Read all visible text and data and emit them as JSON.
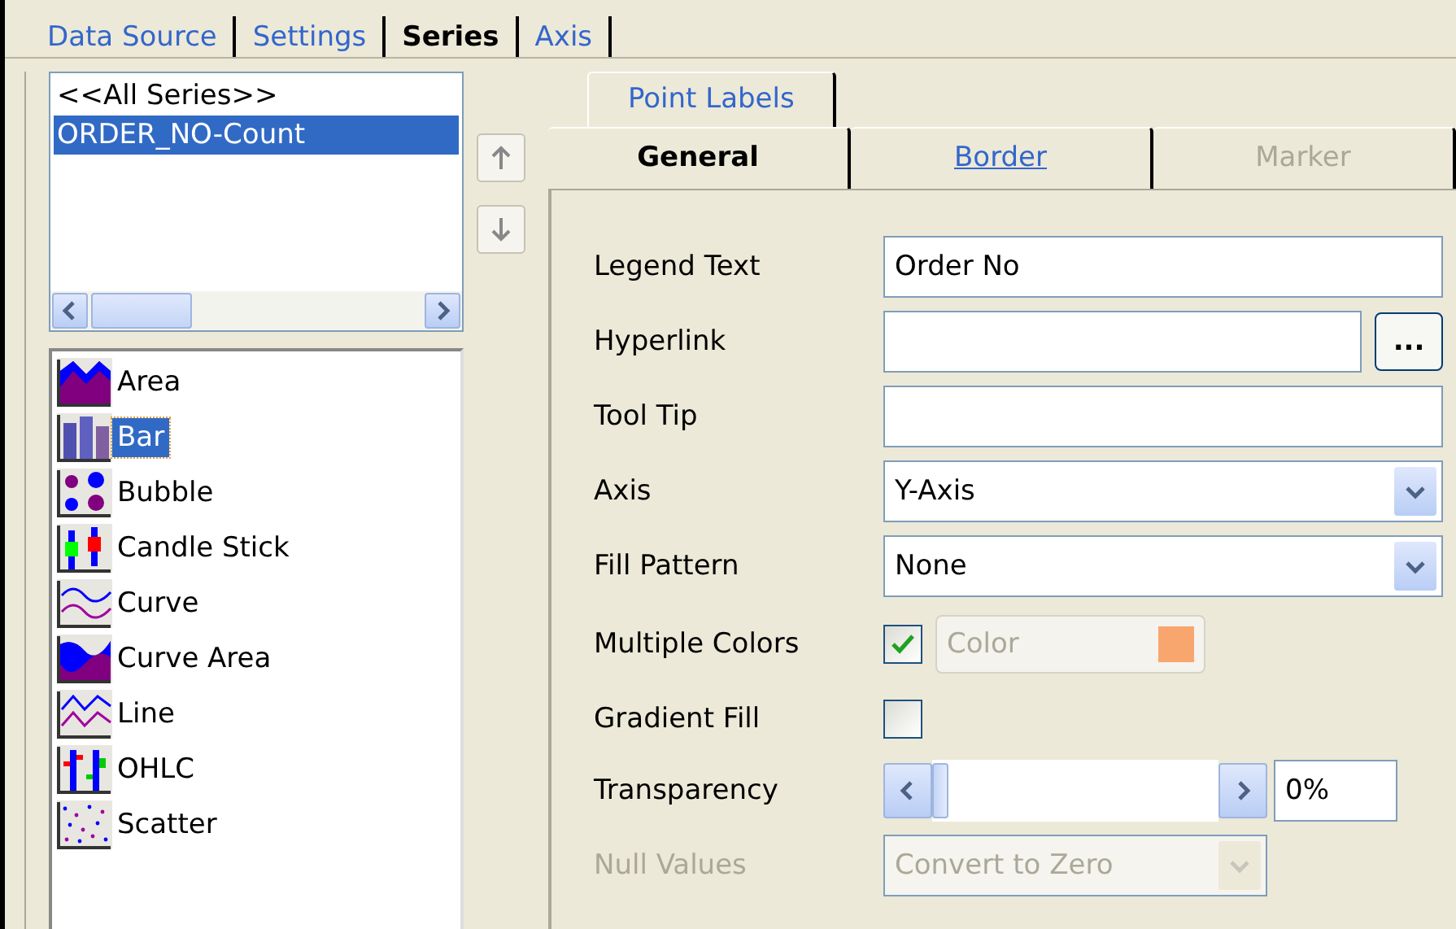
{
  "tabs": [
    {
      "label": "Data Source",
      "selected": false
    },
    {
      "label": "Settings",
      "selected": false
    },
    {
      "label": "Series",
      "selected": true
    },
    {
      "label": "Axis",
      "selected": false
    }
  ],
  "series_list": [
    {
      "label": "<<All Series>>",
      "selected": false
    },
    {
      "label": "ORDER_NO-Count",
      "selected": true
    }
  ],
  "chart_types": [
    {
      "label": "Area",
      "kind": "area",
      "selected": false
    },
    {
      "label": "Bar",
      "kind": "bar",
      "selected": true
    },
    {
      "label": "Bubble",
      "kind": "bubble",
      "selected": false
    },
    {
      "label": "Candle Stick",
      "kind": "candle",
      "selected": false
    },
    {
      "label": "Curve",
      "kind": "curve",
      "selected": false
    },
    {
      "label": "Curve Area",
      "kind": "curvearea",
      "selected": false
    },
    {
      "label": "Line",
      "kind": "line",
      "selected": false
    },
    {
      "label": "OHLC",
      "kind": "ohlc",
      "selected": false
    },
    {
      "label": "Scatter",
      "kind": "scatter",
      "selected": false
    }
  ],
  "upper_tabs": [
    {
      "label": "Point Labels",
      "selected": false,
      "disabled": false
    }
  ],
  "lower_tabs": [
    {
      "label": "General",
      "selected": true,
      "disabled": false
    },
    {
      "label": "Border",
      "selected": false,
      "disabled": false
    },
    {
      "label": "Marker",
      "selected": false,
      "disabled": true
    }
  ],
  "fields": [
    {
      "kind": "text",
      "label": "Legend Text",
      "value": "Order No",
      "disabled": false
    },
    {
      "kind": "browse",
      "label": "Hyperlink",
      "button": "...",
      "disabled": false
    },
    {
      "kind": "text",
      "label": "Tool Tip",
      "disabled": false
    },
    {
      "kind": "select",
      "label": "Axis",
      "value": "Y-Axis",
      "disabled": false
    },
    {
      "kind": "select",
      "label": "Fill Pattern",
      "value": "None",
      "disabled": false
    },
    {
      "kind": "checkcolor",
      "label": "Multiple Colors",
      "checked": true,
      "color_label": "Color",
      "color": "#f9a66e",
      "disabled": false
    },
    {
      "kind": "check",
      "label": "Gradient Fill",
      "checked": false,
      "disabled": false
    },
    {
      "kind": "slider",
      "label": "Transparency",
      "level": 0,
      "reading": "0%",
      "disabled": false
    },
    {
      "kind": "select",
      "label": "Null Values",
      "value": "Convert to Zero",
      "disabled": true
    }
  ]
}
